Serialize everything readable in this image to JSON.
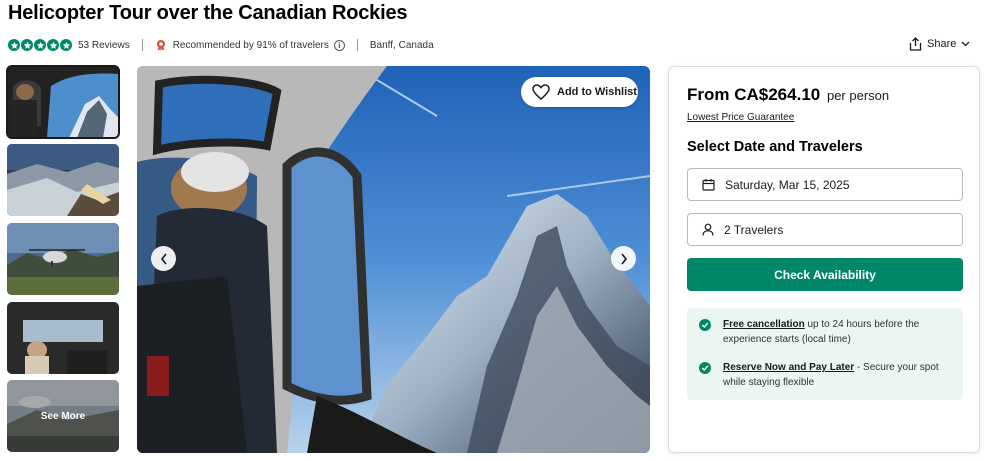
{
  "product": {
    "title": "Helicopter Tour over the Canadian Rockies",
    "rating_stars": 5,
    "reviews": "53 Reviews",
    "recommended": "Recommended by 91% of travelers",
    "location": "Banff, Canada",
    "share_label": "Share"
  },
  "gallery": {
    "see_more": "See More",
    "wishlist_label": "Add to Wishlist"
  },
  "booking": {
    "price_prefix": "From CA$264.10",
    "price_suffix": "per person",
    "lowest_price": "Lowest Price Guarantee",
    "section_title": "Select Date and Travelers",
    "date_value": "Saturday, Mar 15, 2025",
    "travelers_value": "2 Travelers",
    "cta_label": "Check Availability",
    "perks": [
      {
        "link": "Free cancellation",
        "text": " up to 24 hours before the experience starts (local time)"
      },
      {
        "link": "Reserve Now and Pay Later",
        "text": " - Secure your spot while staying flexible"
      }
    ]
  },
  "colors": {
    "brand": "#008768",
    "perk_bg": "#ebf5f1"
  },
  "icons": [
    "star-icon",
    "award-icon",
    "info-icon",
    "share-icon",
    "chevron-down-icon",
    "heart-icon",
    "chevron-left-icon",
    "chevron-right-icon",
    "calendar-icon",
    "person-icon",
    "check-circle-icon"
  ]
}
